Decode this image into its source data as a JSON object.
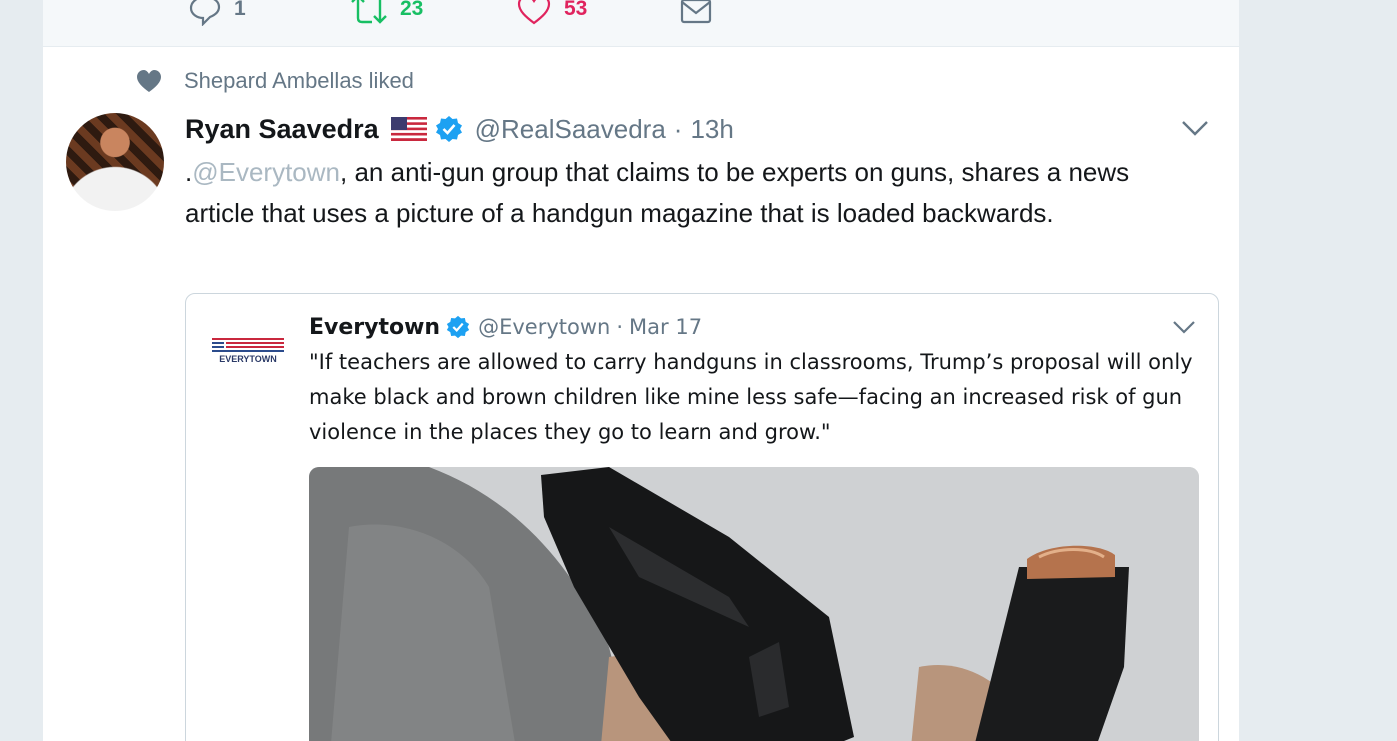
{
  "previous_tweet": {
    "actions": {
      "reply_count": "1",
      "retweet_count": "23",
      "like_count": "53"
    }
  },
  "social_context": {
    "text": "Shepard Ambellas liked"
  },
  "tweet": {
    "author_name": "Ryan Saavedra",
    "handle": "@RealSaavedra",
    "separator": "·",
    "time": "13h",
    "text_prefix": ".",
    "mention": "@Everytown",
    "text_rest": ", an anti-gun group that claims to be experts on guns, shares a news article that uses a picture of a handgun magazine that is loaded backwards."
  },
  "quoted_tweet": {
    "author_name": "Everytown",
    "handle": "@Everytown",
    "separator": "·",
    "time": "Mar 17",
    "logo_text": "EVERYTOWN",
    "text": "\"If teachers are allowed to carry handguns in classrooms, Trump’s proposal will only make black and brown children like mine less safe—facing an increased risk of gun violence in the places they go to learn and grow.\""
  },
  "colors": {
    "retweet_green": "#17bf63",
    "like_red": "#e0245e",
    "verified_blue": "#1da1f2",
    "secondary_gray": "#657786"
  }
}
